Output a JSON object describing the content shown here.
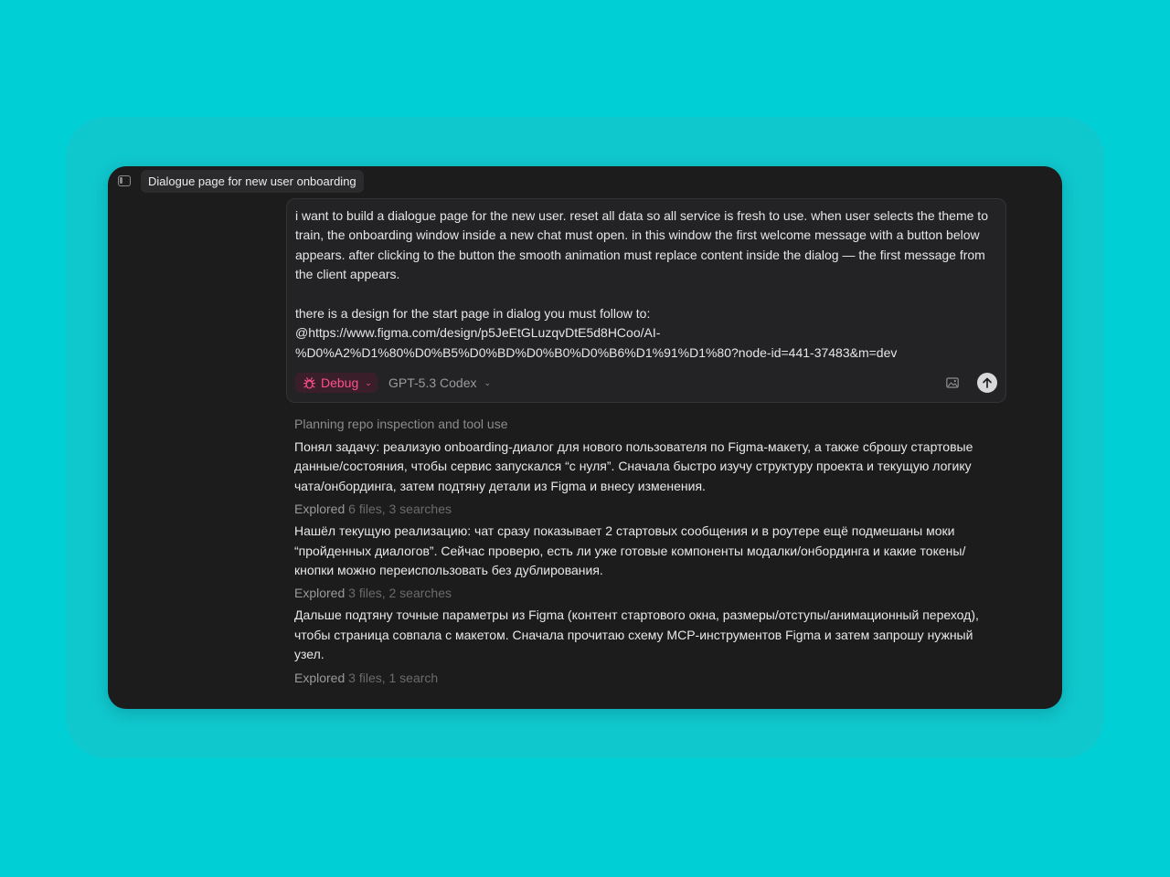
{
  "window": {
    "title": "Dialogue page for new user onboarding"
  },
  "prompt": {
    "paragraph1": "i want to build a dialogue page for the new user. reset all data so all service is fresh to use. when user selects the theme to train, the onboarding window inside a new chat must open. in this window the first welcome message with a button below appears. after clicking to the button the smooth animation must replace content inside the dialog — the first message from the client appears.",
    "paragraph2_line1": "there is a design for the start page in dialog you must follow to:",
    "url_line1": "@https://www.figma.com/design/p5JeEtGLuzqvDtE5d8HCoo/AI-",
    "url_line2": "%D0%A2%D1%80%D0%B5%D0%BD%D0%B0%D0%B6%D1%91%D1%80?node-id=441-37483&m=dev"
  },
  "composer": {
    "mode_label": "Debug",
    "mode_icon": "bug-icon",
    "model_label": "GPT-5.3 Codex",
    "accent_color": "#ff4f8b"
  },
  "transcript": {
    "status": "Planning repo inspection and tool use",
    "messages": [
      "Понял задачу: реализую onboarding-диалог для нового пользователя по Figma-макету, а также сброшу стартовые данные/состояния, чтобы сервис запускался “с нуля”. Сначала быстро изучу структуру проекта и текущую логику чата/онбординга, затем подтяну детали из Figma и внесу изменения.",
      "Нашёл текущую реализацию: чат сразу показывает 2 стартовых сообщения и в роутере ещё подмешаны моки “пройденных диалогов”. Сейчас проверю, есть ли уже готовые компоненты модалки/онбординга и какие токены/кнопки можно переиспользовать без дублирования.",
      "Дальше подтяну точные параметры из Figma (контент стартового окна, размеры/отступы/анимационный переход), чтобы страница совпала с макетом. Сначала прочитаю схему MCP-инструментов Figma и затем запрошу нужный узел."
    ],
    "steps": [
      {
        "verb": "Explored",
        "detail": "6 files, 3 searches"
      },
      {
        "verb": "Explored",
        "detail": "3 files, 2 searches"
      },
      {
        "verb": "Explored",
        "detail": "3 files, 1 search"
      }
    ]
  }
}
